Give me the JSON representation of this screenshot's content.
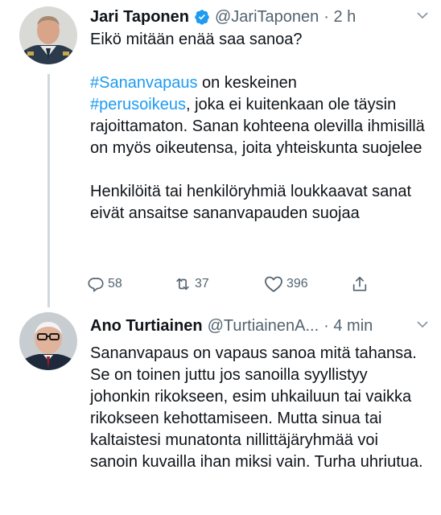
{
  "tweets": [
    {
      "name": "Jari Taponen",
      "handle": "@JariTaponen",
      "time": "· 2 h",
      "line1": "Eikö mitään enää saa sanoa?",
      "hashtag1": "#Sananvapaus",
      "text_after_hashtag1": " on keskeinen",
      "hashtag2": "#perusoikeus",
      "text_after_hashtag2": ", joka ei kuitenkaan ole täysin rajoittamaton. Sanan kohteena olevilla ihmisillä on myös oikeutensa, joita yhteiskunta suojelee",
      "paragraph3": "Henkilöitä tai henkilöryhmiä loukkaavat sanat eivät ansaitse sananvapauden suojaa",
      "replies": "58",
      "retweets": "37",
      "likes": "396"
    },
    {
      "name": "Ano Turtiainen",
      "handle": "@TurtiainenA...",
      "time": "· 4 min",
      "text": "Sananvapaus on vapaus sanoa mitä tahansa. Se on toinen juttu jos sanoilla syyllistyy johonkin rikokseen, esim uhkailuun tai vaikka rikokseen kehottamiseen. Mutta sinua tai kaltaistesi munatonta nillittäjäryhmää voi sanoin kuvailla ihan miksi vain. Turha uhriutua."
    }
  ],
  "icons": {
    "verified": "verified-badge-icon",
    "more": "chevron-down-icon",
    "reply": "reply-icon",
    "retweet": "retweet-icon",
    "like": "heart-icon",
    "share": "share-icon"
  },
  "colors": {
    "hashtag": "#1d9bf0",
    "verified": "#1d9bf0",
    "secondary_text": "#536471",
    "thread_line": "#cfd9de"
  }
}
